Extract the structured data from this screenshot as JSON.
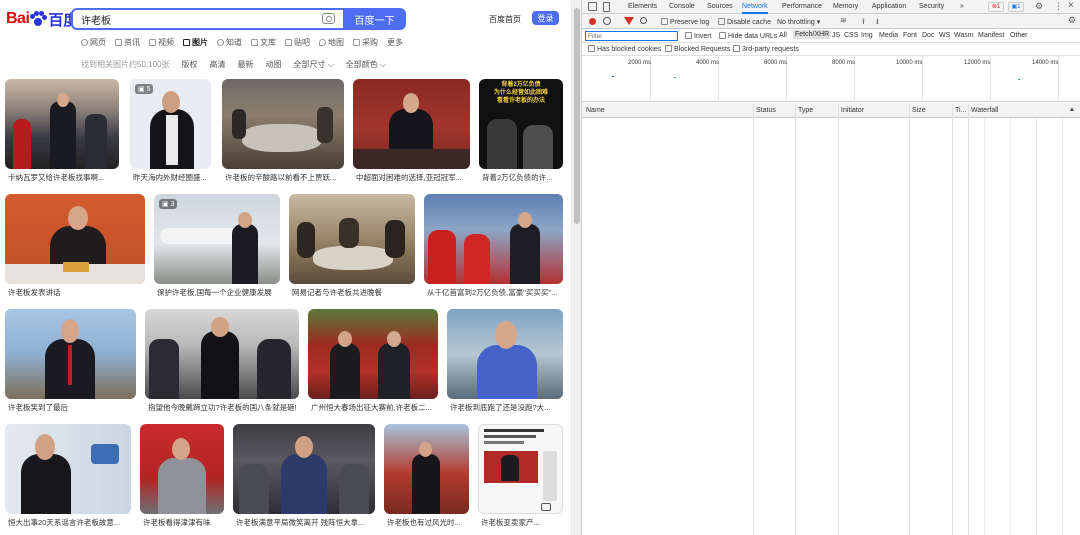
{
  "search": {
    "query": "许老板",
    "button": "百度一下"
  },
  "logo": {
    "bai": "Bai",
    "du": "百度"
  },
  "header_links": {
    "home": "百度首页",
    "login": "登录"
  },
  "tabs": [
    "网页",
    "资讯",
    "视频",
    "图片",
    "知道",
    "文库",
    "贴吧",
    "地图",
    "采购",
    "更多"
  ],
  "active_tab": "图片",
  "filters": {
    "count": "找到相关图片约50,100张",
    "items": [
      "版权",
      "高清",
      "最新",
      "动图",
      "全部尺寸 ⌵",
      "全部颜色 ⌵"
    ]
  },
  "badges": {
    "b1": "5",
    "b2": "3"
  },
  "captions": [
    "卡纳瓦罗又给许老板找事啊...",
    "昨天海内外财经圈盛...",
    "许老板的辛酸路以前看不上贾跃...",
    "中超面对困难的选择,亚冠冠军...",
    "背着2万亿负债的许...",
    "许老板发表讲话",
    "保护许老板,国每一个企业健康发展",
    "网易记者与许老板共进晚餐",
    "从千亿首富到2万亿负债,富豪\"买买买\"...",
    "许老板笑到了最后",
    "指望他今晚戴蹄立功?许老板的国八条就是砸!",
    "广州恒大春场出征大赛前,许老板二...",
    "许老板到底跑了还是没跑?大...",
    "恒大出事20天系谣言许老板故意...",
    "许老板看得津津有味",
    "许老板满意平局微笑离开 残阵恒大拿...",
    "许老板也有过风光时...",
    "许老板变卖家产..."
  ],
  "thumb_text": {
    "t5_a": "背着2万亿负债",
    "t5_b": "为什么经营如此困难",
    "t5_c": "看看许老板的办法"
  },
  "devtools": {
    "tabs": [
      "Elements",
      "Console",
      "Sources",
      "Network",
      "Performance",
      "Memory",
      "Application",
      "Security",
      "»"
    ],
    "active": "Network",
    "errors": "1",
    "messages": "1",
    "toolbar": {
      "preserve": "Preserve log",
      "disable_cache": "Disable cache",
      "throttle": "No throttling"
    },
    "filter": {
      "placeholder": "Filter",
      "invert": "Invert",
      "hide_data": "Hide data URLs",
      "types": [
        "All",
        "Fetch/XHR",
        "JS",
        "CSS",
        "Img",
        "Media",
        "Font",
        "Doc",
        "WS",
        "Wasm",
        "Manifest",
        "Other"
      ],
      "active_type": "Fetch/XHR"
    },
    "row4": {
      "blocked_cookies": "Has blocked cookies",
      "blocked_requests": "Blocked Requests",
      "third_party": "3rd-party requests"
    },
    "timeline": [
      "2000 ms",
      "4000 ms",
      "6000 ms",
      "8000 ms",
      "10000 ms",
      "12000 ms",
      "14000 ms"
    ],
    "columns": [
      "Name",
      "Status",
      "Type",
      "Initiator",
      "Size",
      "Ti...",
      "Waterfall"
    ]
  }
}
